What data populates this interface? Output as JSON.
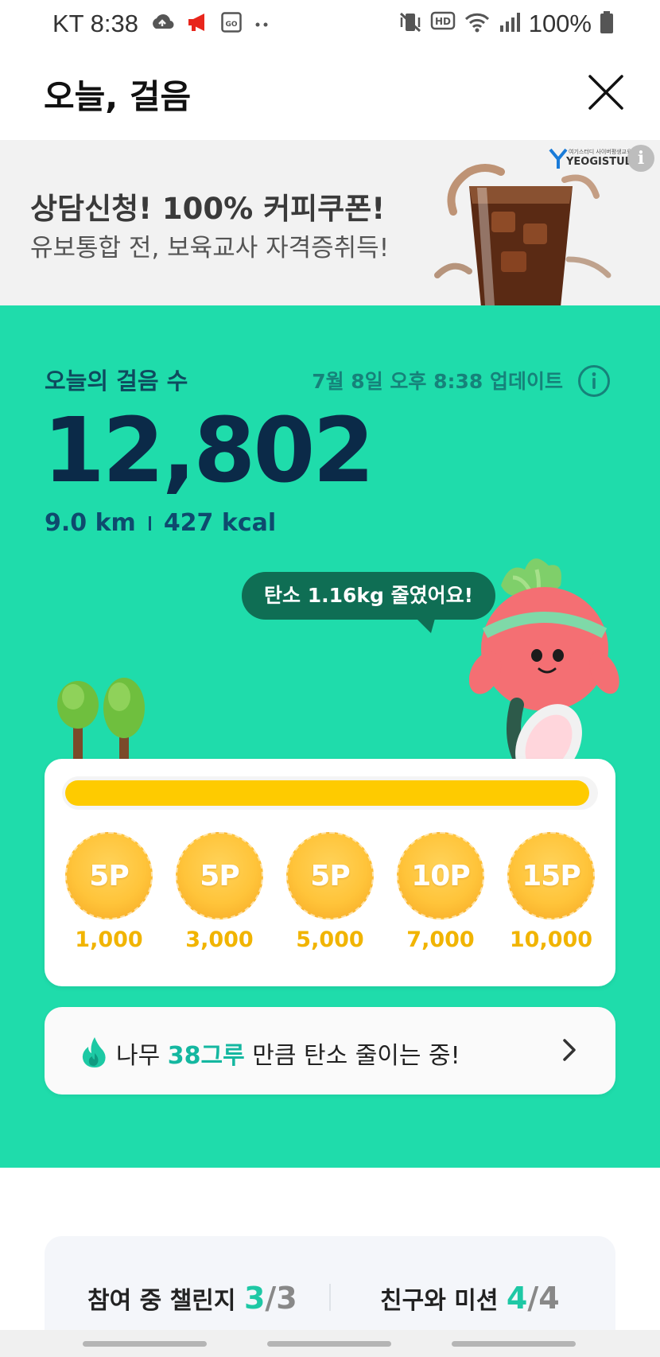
{
  "status_bar": {
    "carrier_time": "KT 8:38",
    "battery": "100%",
    "icons": [
      "cloud-upload-icon",
      "megaphone-icon",
      "go-app-icon",
      "more-dots-icon",
      "vibrate-icon",
      "hd-icon",
      "wifi-icon",
      "signal-icon",
      "battery-icon"
    ]
  },
  "header": {
    "title": "오늘, 걸음"
  },
  "ad": {
    "title": "상담신청! 100% 커피쿠폰!",
    "subtitle": "유보통합 전, 보육교사 자격증취득!",
    "brand": "YEOGISTUDY",
    "brand_sub": "여기스터디 사이버평생교육원",
    "info_label": "i"
  },
  "steps": {
    "label": "오늘의 걸음 수",
    "updated": "7월 8일 오후 8:38 업데이트",
    "count": "12,802",
    "distance": "9.0 km",
    "calories": "427 kcal",
    "carbon_bubble": "탄소 1.16kg 줄였어요!"
  },
  "progress": {
    "fraction": 0.99,
    "rewards": [
      {
        "points": "5P",
        "steps": "1,000"
      },
      {
        "points": "5P",
        "steps": "3,000"
      },
      {
        "points": "5P",
        "steps": "5,000"
      },
      {
        "points": "10P",
        "steps": "7,000"
      },
      {
        "points": "15P",
        "steps": "10,000"
      }
    ]
  },
  "tree_banner": {
    "prefix": "나무 ",
    "highlight": "38그루",
    "suffix": " 만큼 탄소 줄이는 중!"
  },
  "bottom": {
    "challenge_label": "참여 중 챌린지 ",
    "challenge_num": "3",
    "challenge_den": "/3",
    "mission_label": "친구와 미션 ",
    "mission_num": "4",
    "mission_den": "/4"
  },
  "colors": {
    "green": "#1fdcab",
    "navy": "#0b2a48",
    "yellow": "#fecb00",
    "teal": "#14b7a0"
  }
}
